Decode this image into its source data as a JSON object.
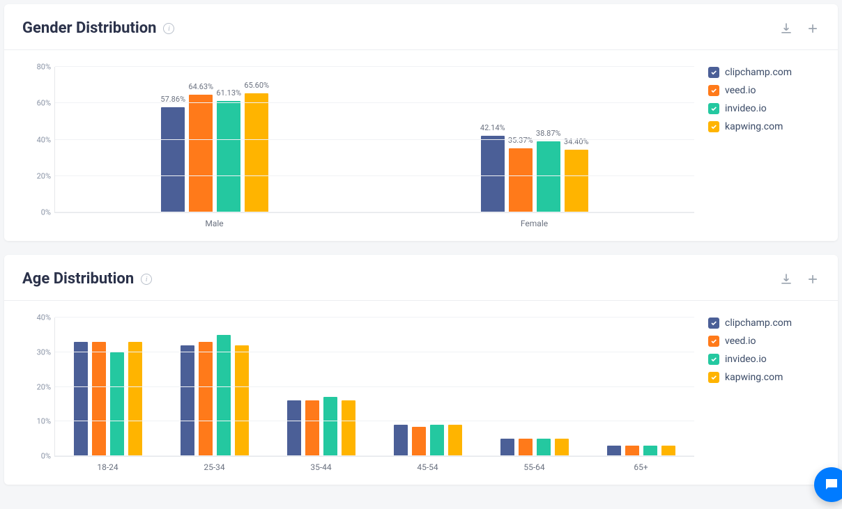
{
  "colors": {
    "clipchamp": "#4b5f97",
    "veed": "#ff7a1a",
    "invideo": "#24c8a0",
    "kapwing": "#ffb400"
  },
  "legend": {
    "clipchamp": "clipchamp.com",
    "veed": "veed.io",
    "invideo": "invideo.io",
    "kapwing": "kapwing.com"
  },
  "gender_card": {
    "title": "Gender Distribution"
  },
  "age_card": {
    "title": "Age Distribution"
  },
  "chart_data": [
    {
      "id": "gender",
      "type": "bar",
      "title": "Gender Distribution",
      "categories": [
        "Male",
        "Female"
      ],
      "ylabel": "",
      "xlabel": "",
      "ylim": [
        0,
        80
      ],
      "yticks": [
        0,
        20,
        40,
        60,
        80
      ],
      "ytick_labels": [
        "0%",
        "20%",
        "40%",
        "60%",
        "80%"
      ],
      "show_labels": true,
      "series": [
        {
          "name": "clipchamp.com",
          "color": "#4b5f97",
          "values": [
            57.86,
            42.14
          ]
        },
        {
          "name": "veed.io",
          "color": "#ff7a1a",
          "values": [
            64.63,
            35.37
          ]
        },
        {
          "name": "invideo.io",
          "color": "#24c8a0",
          "values": [
            61.13,
            38.87
          ]
        },
        {
          "name": "kapwing.com",
          "color": "#ffb400",
          "values": [
            65.6,
            34.4
          ]
        }
      ]
    },
    {
      "id": "age",
      "type": "bar",
      "title": "Age Distribution",
      "categories": [
        "18-24",
        "25-34",
        "35-44",
        "45-54",
        "55-64",
        "65+"
      ],
      "ylabel": "",
      "xlabel": "",
      "ylim": [
        0,
        40
      ],
      "yticks": [
        0,
        10,
        20,
        30,
        40
      ],
      "ytick_labels": [
        "0%",
        "10%",
        "20%",
        "30%",
        "40%"
      ],
      "show_labels": false,
      "series": [
        {
          "name": "clipchamp.com",
          "color": "#4b5f97",
          "values": [
            33,
            32,
            16,
            9,
            5,
            3
          ]
        },
        {
          "name": "veed.io",
          "color": "#ff7a1a",
          "values": [
            33,
            33,
            16,
            8.5,
            5,
            3
          ]
        },
        {
          "name": "invideo.io",
          "color": "#24c8a0",
          "values": [
            30,
            35,
            17,
            9,
            5,
            3
          ]
        },
        {
          "name": "kapwing.com",
          "color": "#ffb400",
          "values": [
            33,
            32,
            16,
            9,
            5,
            3
          ]
        }
      ]
    }
  ]
}
